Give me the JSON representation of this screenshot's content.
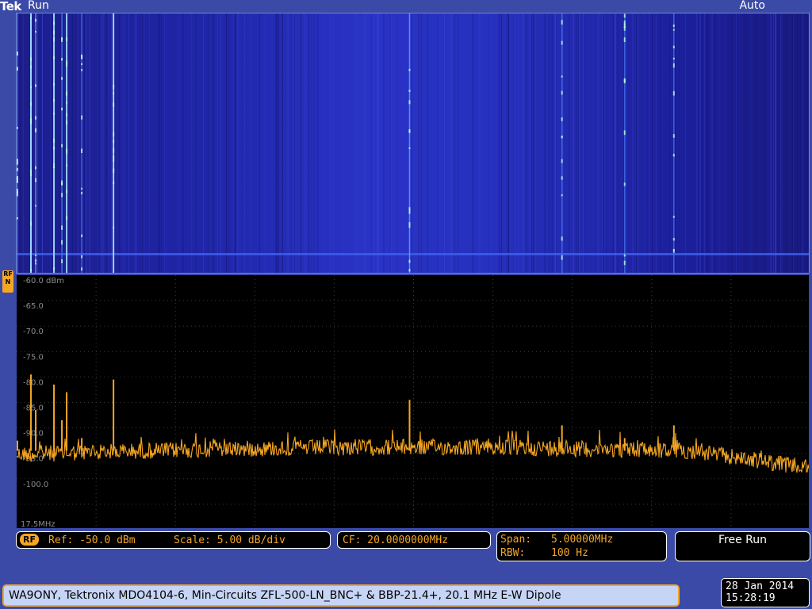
{
  "header": {
    "brand": "Tek",
    "run_state": "Run",
    "trigger_mode": "Auto"
  },
  "colors": {
    "trace": "#f5a623",
    "background": "#3b4aa6",
    "grid": "#3a3a3a",
    "waterfall_base": "#1a1fa8"
  },
  "spectrum": {
    "y_labels": [
      "-60.0 dBm",
      "-65.0",
      "-70.0",
      "-75.0",
      "-80.0",
      "-85.0",
      "-90.0",
      "-95.0",
      "-100.0"
    ],
    "start_freq_label": "17.5MHz",
    "rf_marker": [
      "RF",
      "N"
    ],
    "peaks": [
      {
        "x": 0.0,
        "value": -92.5
      },
      {
        "x": 0.017,
        "value": -79.5
      },
      {
        "x": 0.023,
        "value": -86.5
      },
      {
        "x": 0.046,
        "value": -81.5
      },
      {
        "x": 0.056,
        "value": -88.5
      },
      {
        "x": 0.062,
        "value": -83.0
      },
      {
        "x": 0.081,
        "value": -92.0
      },
      {
        "x": 0.121,
        "value": -80.5
      },
      {
        "x": 0.494,
        "value": -84.5
      },
      {
        "x": 0.686,
        "value": -89.5
      },
      {
        "x": 0.765,
        "value": -92.0
      },
      {
        "x": 0.827,
        "value": -89.5
      }
    ]
  },
  "readouts": {
    "rf_badge": "RF",
    "ref": "Ref: -50.0 dBm",
    "scale": "Scale: 5.00 dB/div",
    "cf": "CF: 20.0000000MHz",
    "span_label": "Span:",
    "span_value": "5.00000MHz",
    "rbw_label": "RBW:",
    "rbw_value": "100 Hz",
    "free_run": "Free Run"
  },
  "footer": {
    "caption": "WA9ONY, Tektronix MDO4104-6, Min-Circuits ZFL-500-LN_BNC+ & BBP-21.4+, 20.1 MHz E-W Dipole",
    "date": "28 Jan 2014",
    "time": "15:28:19"
  }
}
